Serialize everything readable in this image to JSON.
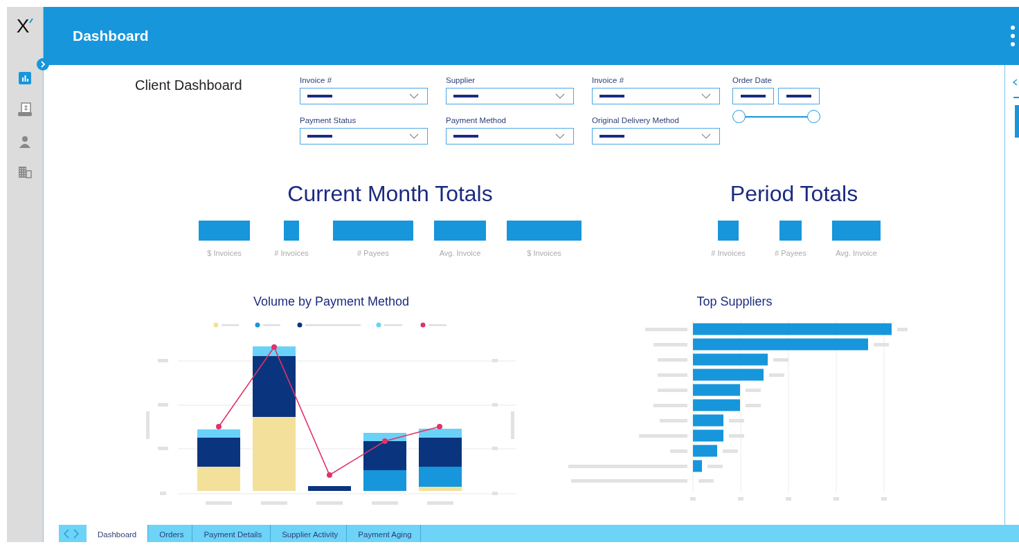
{
  "sidebar": {
    "logo": "X",
    "items": [
      {
        "kind": "chart",
        "selected": true
      },
      {
        "kind": "invoice",
        "selected": false
      },
      {
        "kind": "person",
        "selected": false
      },
      {
        "kind": "building",
        "selected": false
      }
    ]
  },
  "header": {
    "title": "Dashboard"
  },
  "page_title": "Client Dashboard",
  "filters": [
    {
      "label": "Invoice #",
      "kind": "dropdown"
    },
    {
      "label": "Supplier",
      "kind": "dropdown"
    },
    {
      "label": "Invoice #",
      "kind": "dropdown"
    },
    {
      "label": "Order Date",
      "kind": "date_range",
      "level": 1
    },
    {
      "label": "Payment Status",
      "kind": "dropdown"
    },
    {
      "label": "Payment Method",
      "kind": "dropdown"
    },
    {
      "label": "Original Delivery Method",
      "kind": "dropdown"
    }
  ],
  "current_month": {
    "title": "Current Month Totals",
    "metrics": [
      {
        "label": "$ Invoices"
      },
      {
        "label": "# Invoices"
      },
      {
        "label": "# Payees"
      },
      {
        "label": "Avg. Invoice"
      },
      {
        "label": "$ Invoices"
      }
    ]
  },
  "period": {
    "title": "Period Totals",
    "metrics": [
      {
        "label": "# Invoices"
      },
      {
        "label": "# Payees"
      },
      {
        "label": "Avg. Invoice"
      }
    ]
  },
  "charts": [
    {
      "title": "Volume by Payment Method",
      "kind": "stacked"
    },
    {
      "title": "Top Suppliers",
      "kind": "horizontal"
    }
  ],
  "tabs": [
    {
      "label": "Dashboard",
      "selected": true
    },
    {
      "label": "Orders",
      "selected": false
    },
    {
      "label": "Payment Details",
      "selected": false
    },
    {
      "label": "Supplier Activity",
      "selected": false
    },
    {
      "label": "Payment Aging",
      "selected": false
    }
  ]
}
